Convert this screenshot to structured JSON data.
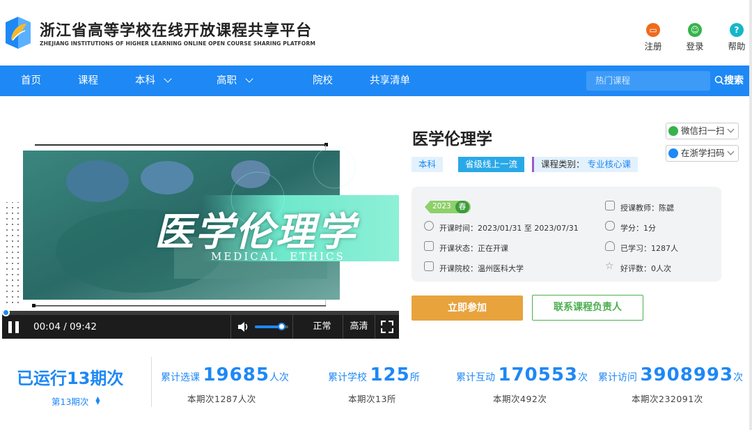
{
  "header": {
    "title": "浙江省高等学校在线开放课程共享平台",
    "subtitle": "ZHEJIANG INSTITUTIONS OF HIGHER LEARNING ONLINE OPEN COURSE SHARING PLATFORM",
    "links": [
      {
        "label": "注册",
        "icon": "register-icon",
        "color": "#f06a1d"
      },
      {
        "label": "登录",
        "icon": "user-icon",
        "color": "#34b34a"
      },
      {
        "label": "帮助",
        "icon": "help-icon",
        "color": "#16b6c8"
      }
    ]
  },
  "nav": {
    "items": [
      "首页",
      "课程",
      "本科",
      "高职",
      "院校",
      "共享清单"
    ],
    "search_placeholder": "热门课程",
    "search_label": "搜索"
  },
  "video": {
    "banner_title": "医学伦理学",
    "banner_subtitle": "MEDICAL  ETHICS",
    "time": "00:04 / 09:42",
    "quality_normal": "正常",
    "quality_hd": "高清",
    "progress": 0.007,
    "volume": 0.8
  },
  "course": {
    "title": "医学伦理学",
    "tags": [
      "本科",
      "省级线上一流"
    ],
    "category_label": "课程类别：",
    "category_value": "专业核心课",
    "share_wechat": "微信扫一扫",
    "share_zj": "在浙学扫码",
    "year": "2023",
    "season": "春",
    "time_label": "开课时间：",
    "time_value": "2023/01/31 至 2023/07/31",
    "status_label": "开课状态：",
    "status_value": "正在开课",
    "school_label": "开课院校：",
    "school_value": "温州医科大学",
    "teacher_label": "授课教师：",
    "teacher_value": "陈勰",
    "credit_label": "学分：",
    "credit_value": "1分",
    "learned_label": "已学习：",
    "learned_value": "1287人",
    "rating_label": "好评数：",
    "rating_value": "0人次",
    "join_label": "立即参加",
    "contact_label": "联系课程负责人"
  },
  "stats": {
    "run_prefix": "已运行",
    "run_count": "13",
    "run_suffix": "期次",
    "term_select": "第13期次",
    "items": [
      {
        "label": "累计选课",
        "value": "19685",
        "unit": "人次",
        "sub": "本期次1287人次"
      },
      {
        "label": "累计学校",
        "value": "125",
        "unit": "所",
        "sub": "本期次13所"
      },
      {
        "label": "累计互动",
        "value": "170553",
        "unit": "次",
        "sub": "本期次492次"
      },
      {
        "label": "累计访问",
        "value": "3908993",
        "unit": "次",
        "sub": "本期次232091次"
      }
    ]
  }
}
